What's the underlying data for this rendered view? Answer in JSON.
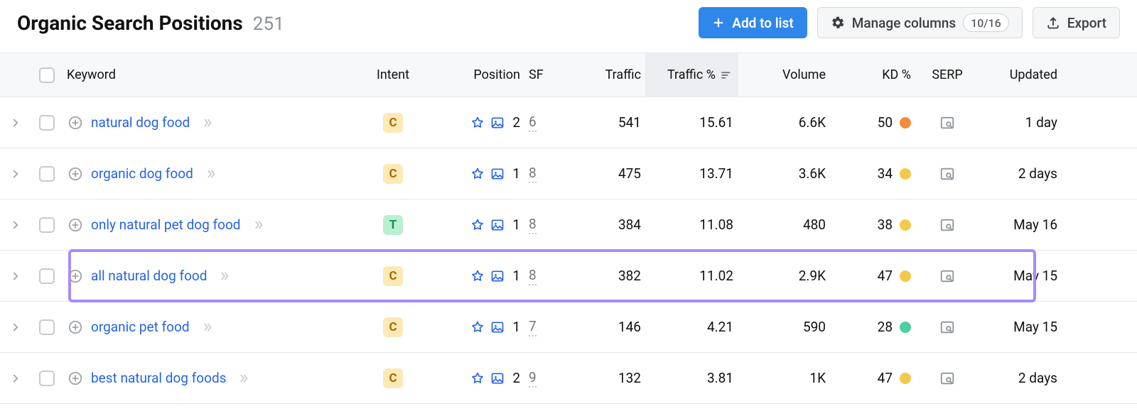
{
  "header": {
    "title": "Organic Search Positions",
    "count": "251",
    "add_label": "Add to list",
    "manage_label": "Manage columns",
    "columns_badge": "10/16",
    "export_label": "Export"
  },
  "columns": {
    "keyword": "Keyword",
    "intent": "Intent",
    "position": "Position",
    "sf": "SF",
    "traffic": "Traffic",
    "traffic_pct": "Traffic %",
    "volume": "Volume",
    "kd": "KD %",
    "serp": "SERP",
    "updated": "Updated"
  },
  "rows": [
    {
      "keyword": "natural dog food",
      "intent": "C",
      "position": "2",
      "sf": "6",
      "traffic": "541",
      "traffic_pct": "15.61",
      "volume": "6.6K",
      "kd": "50",
      "kd_color": "orange",
      "updated": "1 day"
    },
    {
      "keyword": "organic dog food",
      "intent": "C",
      "position": "1",
      "sf": "8",
      "traffic": "475",
      "traffic_pct": "13.71",
      "volume": "3.6K",
      "kd": "34",
      "kd_color": "yellow",
      "updated": "2 days"
    },
    {
      "keyword": "only natural pet dog food",
      "intent": "T",
      "position": "1",
      "sf": "8",
      "traffic": "384",
      "traffic_pct": "11.08",
      "volume": "480",
      "kd": "38",
      "kd_color": "yellow",
      "updated": "May 16"
    },
    {
      "keyword": "all natural dog food",
      "intent": "C",
      "position": "1",
      "sf": "8",
      "traffic": "382",
      "traffic_pct": "11.02",
      "volume": "2.9K",
      "kd": "47",
      "kd_color": "yellow",
      "updated": "May 15",
      "highlight": true
    },
    {
      "keyword": "organic pet food",
      "intent": "C",
      "position": "1",
      "sf": "7",
      "traffic": "146",
      "traffic_pct": "4.21",
      "volume": "590",
      "kd": "28",
      "kd_color": "green",
      "updated": "May 15"
    },
    {
      "keyword": "best natural dog foods",
      "intent": "C",
      "position": "2",
      "sf": "9",
      "traffic": "132",
      "traffic_pct": "3.81",
      "volume": "1K",
      "kd": "47",
      "kd_color": "yellow",
      "updated": "2 days"
    }
  ]
}
